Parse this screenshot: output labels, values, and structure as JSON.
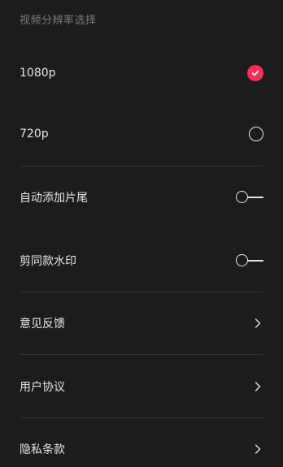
{
  "section": {
    "title": "视频分辨率选择"
  },
  "resolution_options": [
    {
      "label": "1080p",
      "selected": true
    },
    {
      "label": "720p",
      "selected": false
    }
  ],
  "toggles": [
    {
      "label": "自动添加片尾",
      "on": false
    },
    {
      "label": "剪同款水印",
      "on": false
    }
  ],
  "links": [
    {
      "label": "意见反馈"
    },
    {
      "label": "用户协议"
    },
    {
      "label": "隐私条款"
    }
  ],
  "colors": {
    "background": "#1c1c1e",
    "accent": "#fe2c55",
    "divider": "#333336",
    "text": "#e6e6e6",
    "muted": "#7d7d80"
  },
  "icons": {
    "selected": "check-circle-icon",
    "unselected": "radio-empty-icon",
    "toggle": "toggle-off-icon",
    "link": "chevron-right-icon"
  }
}
